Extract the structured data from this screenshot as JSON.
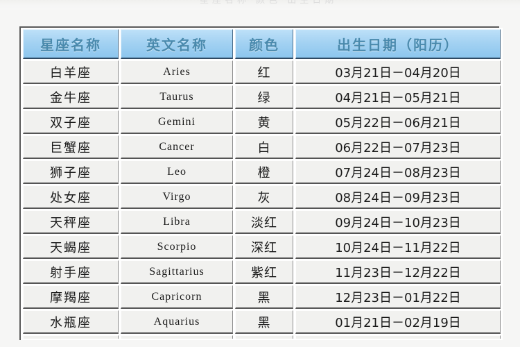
{
  "top_clipped_text": "星座名称  颜色  出生日期",
  "table": {
    "name": "zodiac-signs-table",
    "colors": {
      "header_background": "#a4d2f2",
      "header_text": "#4a8aad",
      "cell_background": "#f1f1ef",
      "cell_text": "#1a1a1a",
      "border_dark": "#555555",
      "page_background": "#f6f6f5"
    },
    "headers": [
      {
        "key": "name",
        "label": "星座名称"
      },
      {
        "key": "eng",
        "label": "英文名称"
      },
      {
        "key": "color",
        "label": "颜色"
      },
      {
        "key": "date",
        "label": "出生日期（阳历）"
      }
    ],
    "rows": [
      {
        "name": "白羊座",
        "eng": "Aries",
        "color": "红",
        "date": "03月21日－04月20日"
      },
      {
        "name": "金牛座",
        "eng": "Taurus",
        "color": "绿",
        "date": "04月21日－05月21日"
      },
      {
        "name": "双子座",
        "eng": "Gemini",
        "color": "黄",
        "date": "05月22日－06月21日"
      },
      {
        "name": "巨蟹座",
        "eng": "Cancer",
        "color": "白",
        "date": "06月22日－07月23日"
      },
      {
        "name": "狮子座",
        "eng": "Leo",
        "color": "橙",
        "date": "07月24日－08月23日"
      },
      {
        "name": "处女座",
        "eng": "Virgo",
        "color": "灰",
        "date": "08月24日－09月23日"
      },
      {
        "name": "天秤座",
        "eng": "Libra",
        "color": "淡红",
        "date": "09月24日－10月23日"
      },
      {
        "name": "天蝎座",
        "eng": "Scorpio",
        "color": "深红",
        "date": "10月24日－11月22日"
      },
      {
        "name": "射手座",
        "eng": "Sagittarius",
        "color": "紫红",
        "date": "11月23日－12月22日"
      },
      {
        "name": "摩羯座",
        "eng": "Capricorn",
        "color": "黑",
        "date": "12月23日－01月22日"
      },
      {
        "name": "水瓶座",
        "eng": "Aquarius",
        "color": "黑",
        "date": "01月21日－02月19日"
      }
    ]
  }
}
